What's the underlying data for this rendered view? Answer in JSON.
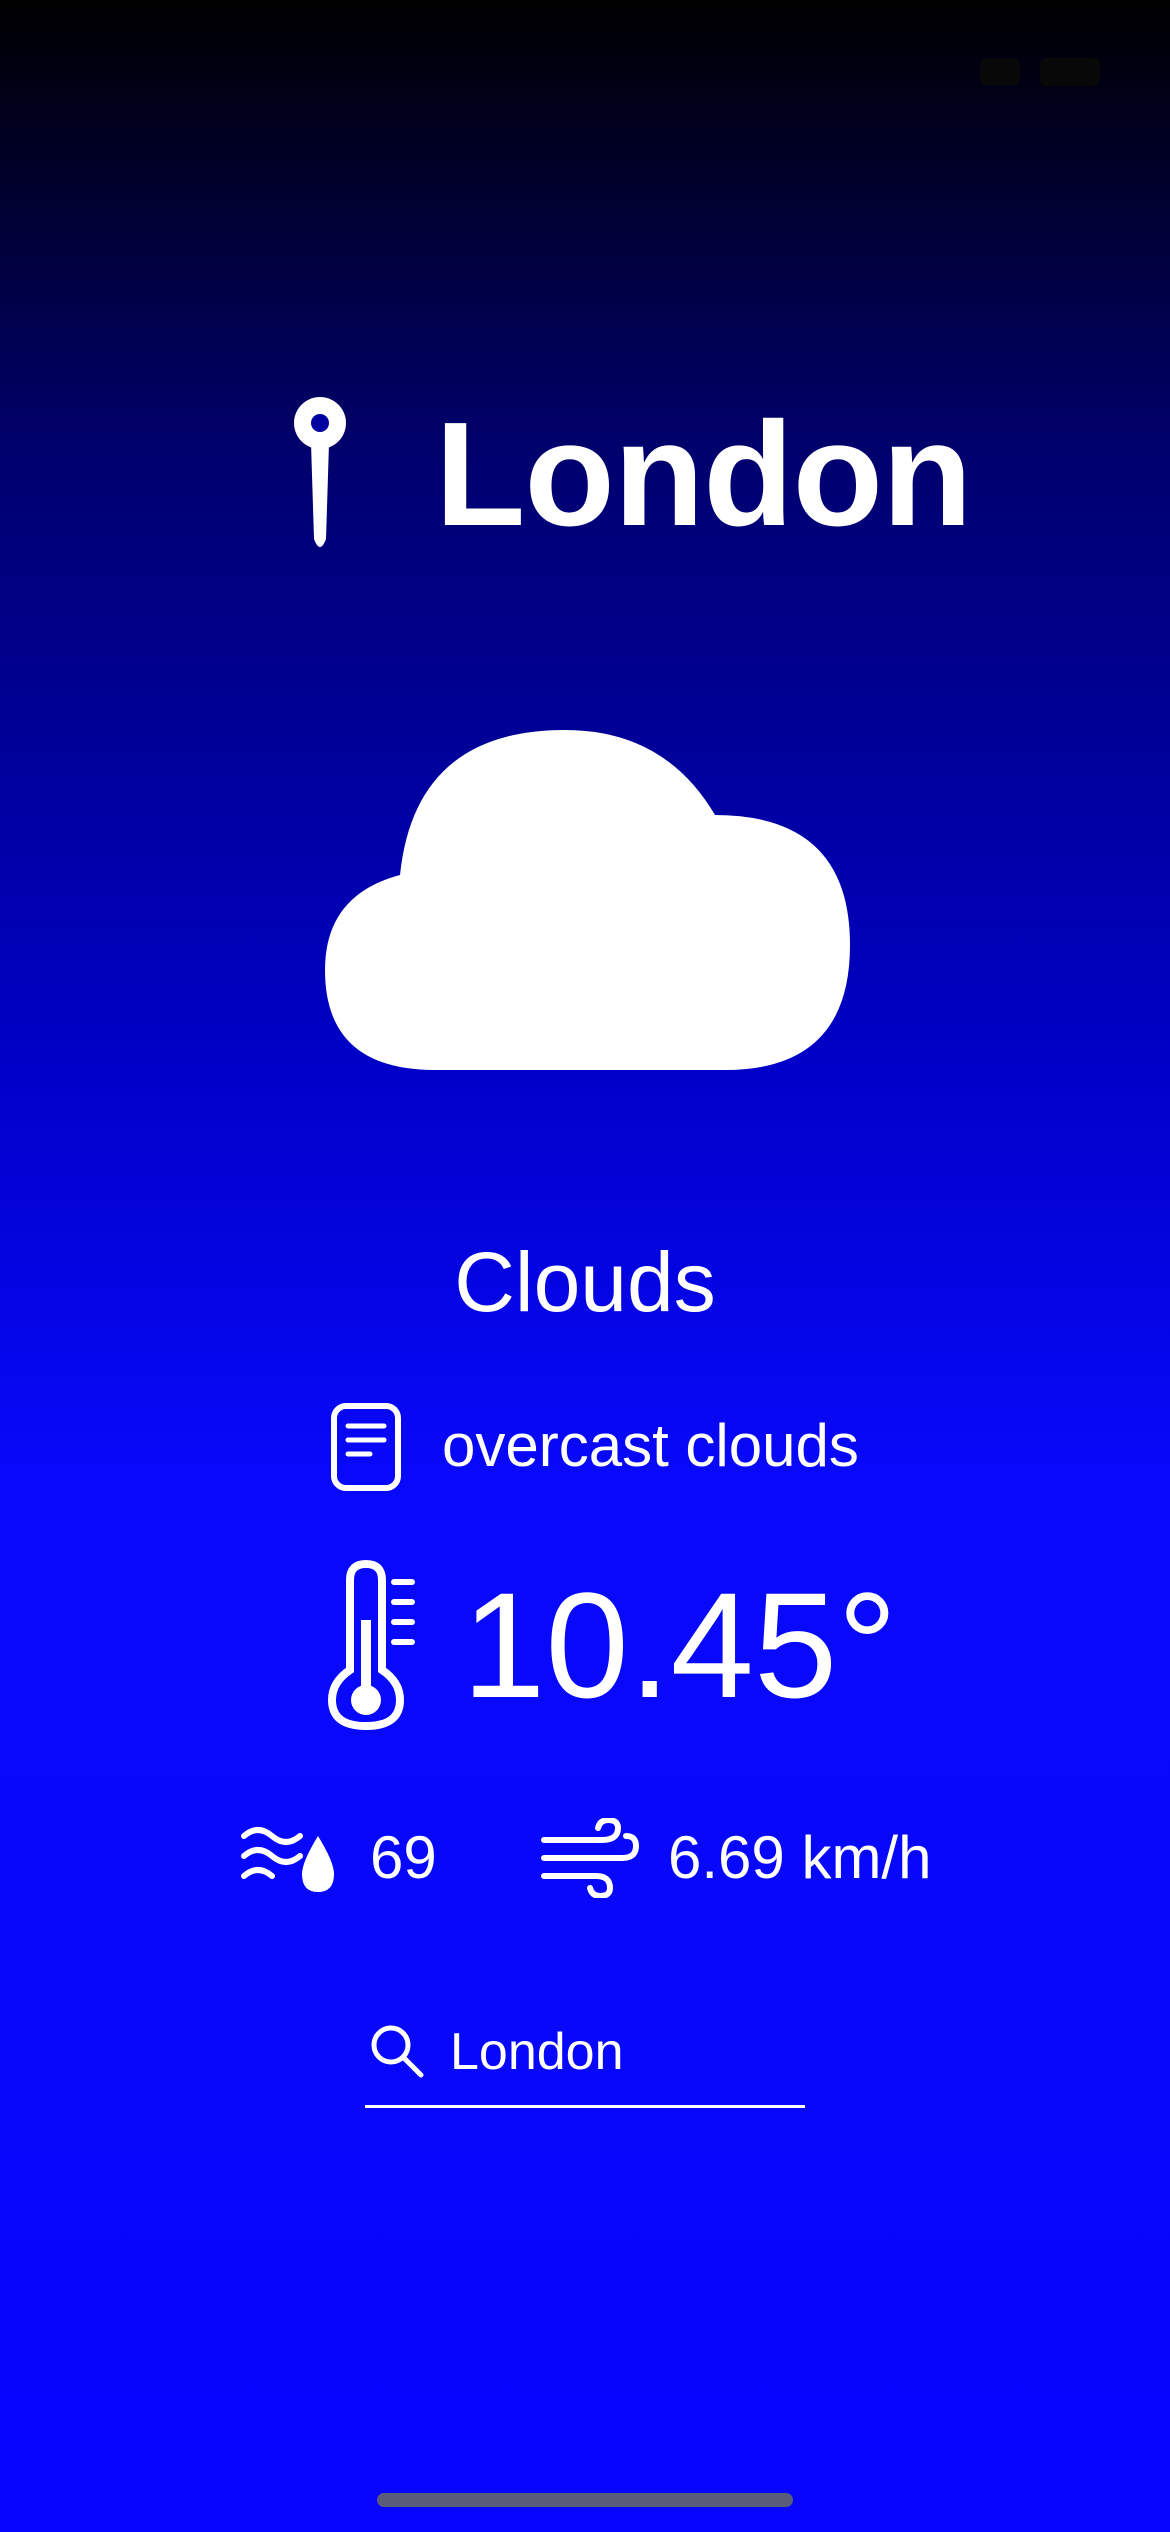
{
  "status_bar": {
    "time": ""
  },
  "location": {
    "city": "London",
    "icon": "pin-icon"
  },
  "weather": {
    "icon": "cloud-icon",
    "condition": "Clouds",
    "description": "overcast clouds",
    "description_icon": "doc-text-icon",
    "temperature": "10.45°",
    "temperature_icon": "thermometer-icon",
    "humidity": "69",
    "humidity_icon": "humidity-icon",
    "wind_speed": "6.69 km/h",
    "wind_icon": "wind-icon"
  },
  "search": {
    "value": "London",
    "placeholder": "",
    "icon": "magnifying-glass-icon"
  },
  "theme": {
    "gradient_top": "#000000",
    "gradient_bottom": "#0606fe",
    "text_color": "#ffffff"
  }
}
